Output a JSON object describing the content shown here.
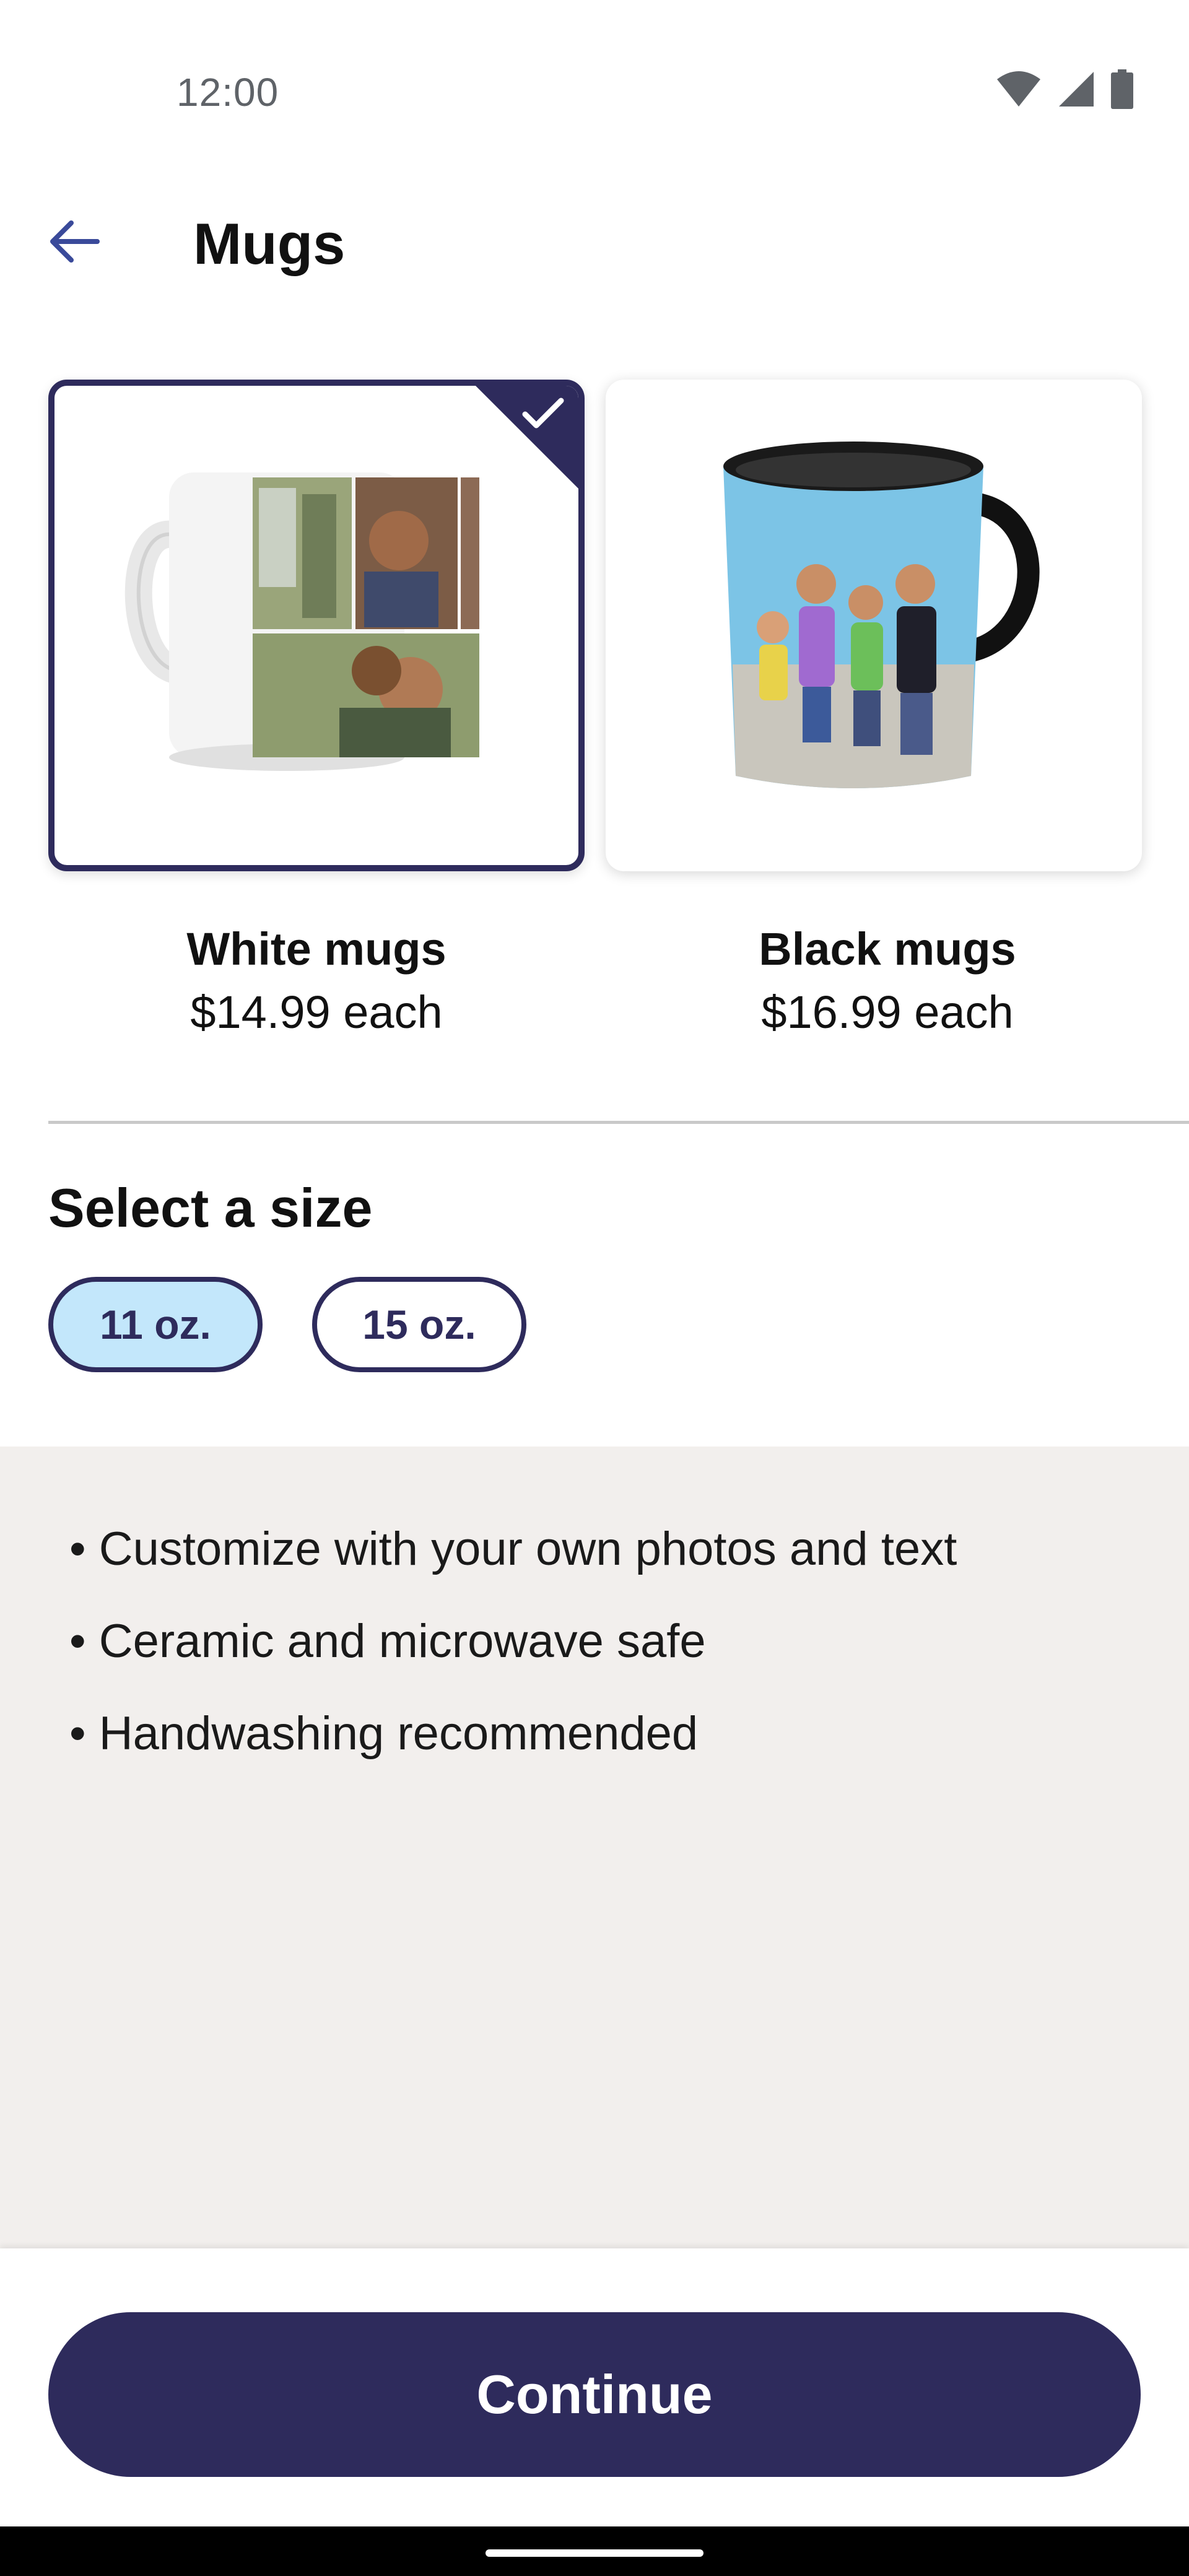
{
  "status_bar": {
    "time": "12:00",
    "icons": [
      "wifi-icon",
      "cellular-signal-icon",
      "battery-icon"
    ]
  },
  "header": {
    "back_icon": "arrow-left-icon",
    "title": "Mugs"
  },
  "options": [
    {
      "name": "White mugs",
      "price": "$14.99 each",
      "selected": true
    },
    {
      "name": "Black mugs",
      "price": "$16.99 each",
      "selected": false
    }
  ],
  "size": {
    "heading": "Select a size",
    "options": [
      {
        "label": "11 oz.",
        "selected": true
      },
      {
        "label": "15 oz.",
        "selected": false
      }
    ]
  },
  "features": [
    "• Customize with your own photos and text",
    "• Ceramic and microwave safe",
    "• Handwashing recommended"
  ],
  "footer": {
    "continue_label": "Continue"
  },
  "colors": {
    "brand_navy": "#2e2b5c",
    "chip_selected_bg": "#c3e7fb",
    "features_bg": "#f2efed"
  }
}
